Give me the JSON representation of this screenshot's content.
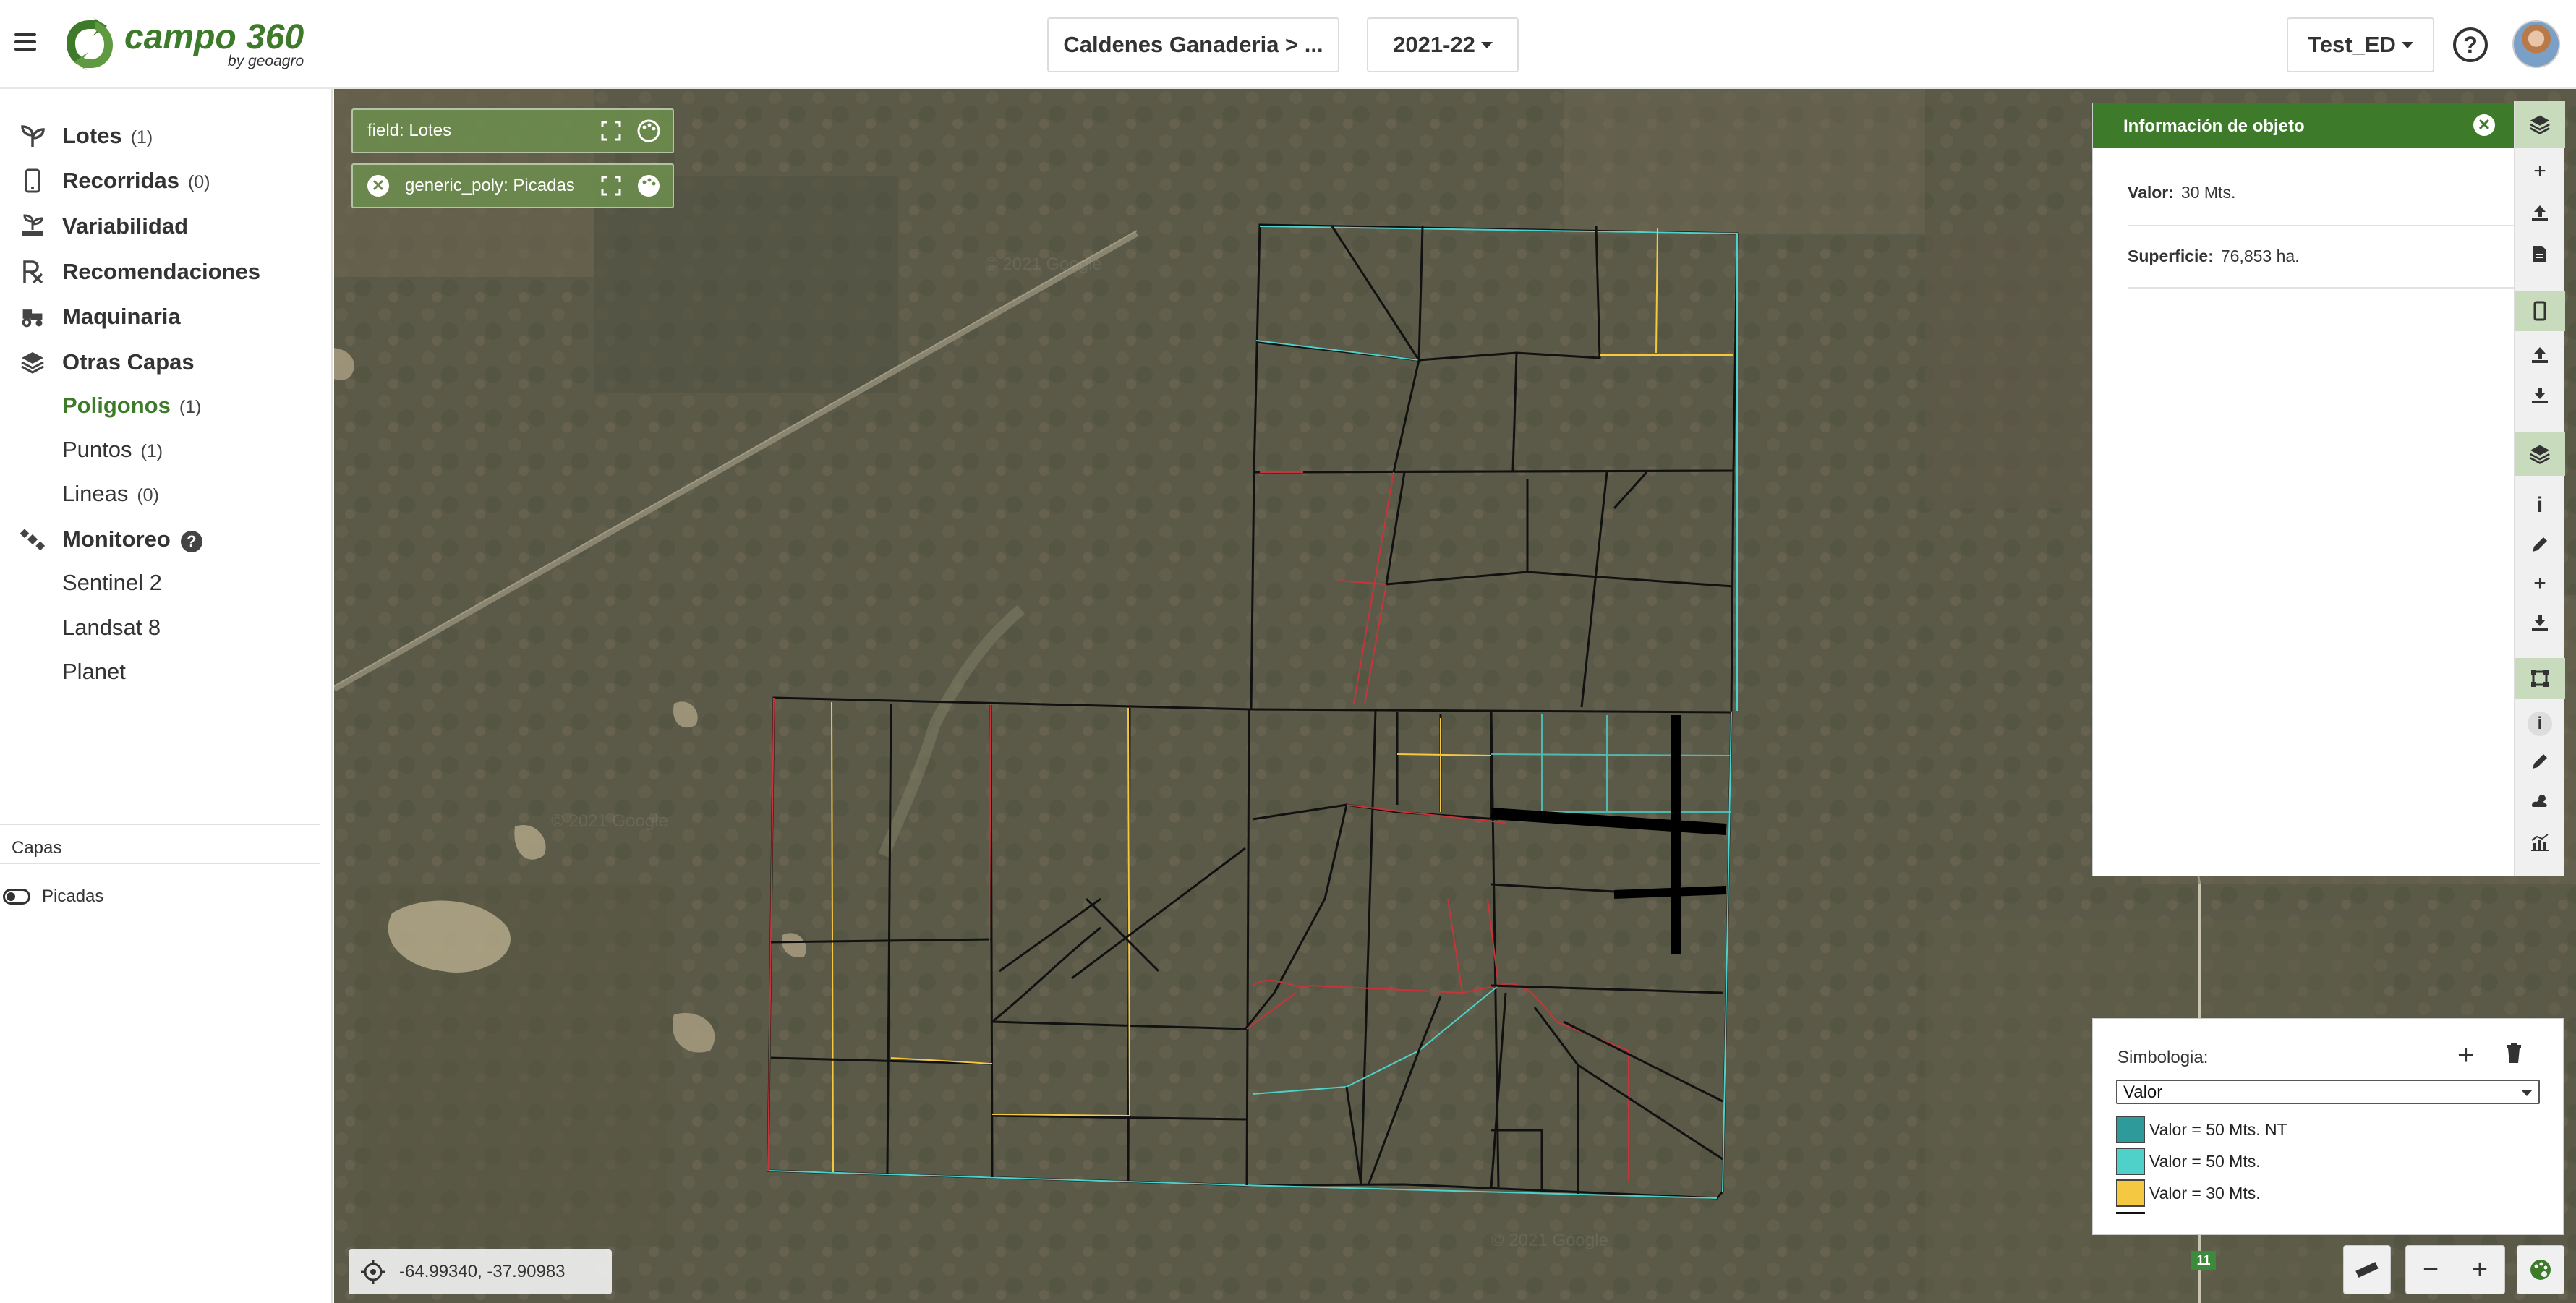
{
  "app": {
    "logo_main": "campo 360",
    "logo_sub": "by geoagro"
  },
  "header": {
    "field_selector": "Caldenes Ganaderia > ...",
    "season_selector": "2021-22",
    "user_selector": "Test_ED",
    "help_glyph": "?"
  },
  "sidebar": {
    "items": [
      {
        "label": "Lotes",
        "count": "(1)",
        "icon": "sprout-icon"
      },
      {
        "label": "Recorridas",
        "count": "(0)",
        "icon": "phone-icon"
      },
      {
        "label": "Variabilidad",
        "count": "",
        "icon": "variability-icon"
      },
      {
        "label": "Recomendaciones",
        "count": "",
        "icon": "prescription-icon"
      },
      {
        "label": "Maquinaria",
        "count": "",
        "icon": "tractor-icon"
      },
      {
        "label": "Otras Capas",
        "count": "",
        "icon": "layers-icon"
      },
      {
        "label": "Poligonos",
        "count": "(1)",
        "icon": ""
      },
      {
        "label": "Puntos",
        "count": "(1)",
        "icon": ""
      },
      {
        "label": "Lineas",
        "count": "(0)",
        "icon": ""
      },
      {
        "label": "Monitoreo",
        "count": "",
        "icon": "satellite-icon"
      },
      {
        "label": "Sentinel 2",
        "count": "",
        "icon": ""
      },
      {
        "label": "Landsat 8",
        "count": "",
        "icon": ""
      },
      {
        "label": "Planet",
        "count": "",
        "icon": ""
      }
    ],
    "capas_title": "Capas",
    "capas_toggle_label": "Picadas"
  },
  "map": {
    "layer_chips": [
      {
        "label": "field: Lotes"
      },
      {
        "label": "generic_poly: Picadas"
      }
    ],
    "coordinates": "-64.99340, -37.90983",
    "road_marker": "11",
    "watermark": "© 2021 Google"
  },
  "info_panel": {
    "title": "Información de objeto",
    "rows": [
      {
        "key": "Valor:",
        "value": "30 Mts."
      },
      {
        "key": "Superficie:",
        "value": "76,853 ha."
      }
    ]
  },
  "legend": {
    "title": "Simbologia:",
    "select_value": "Valor",
    "entries": [
      {
        "label": "Valor = 50 Mts. NT",
        "color": "#2f9a9a"
      },
      {
        "label": "Valor = 50 Mts.",
        "color": "#4fd0c8"
      },
      {
        "label": "Valor = 30 Mts.",
        "color": "#f5c842"
      }
    ]
  },
  "colors": {
    "brand_green": "#3d7a2a",
    "chip_green": "#6b8b4d"
  }
}
